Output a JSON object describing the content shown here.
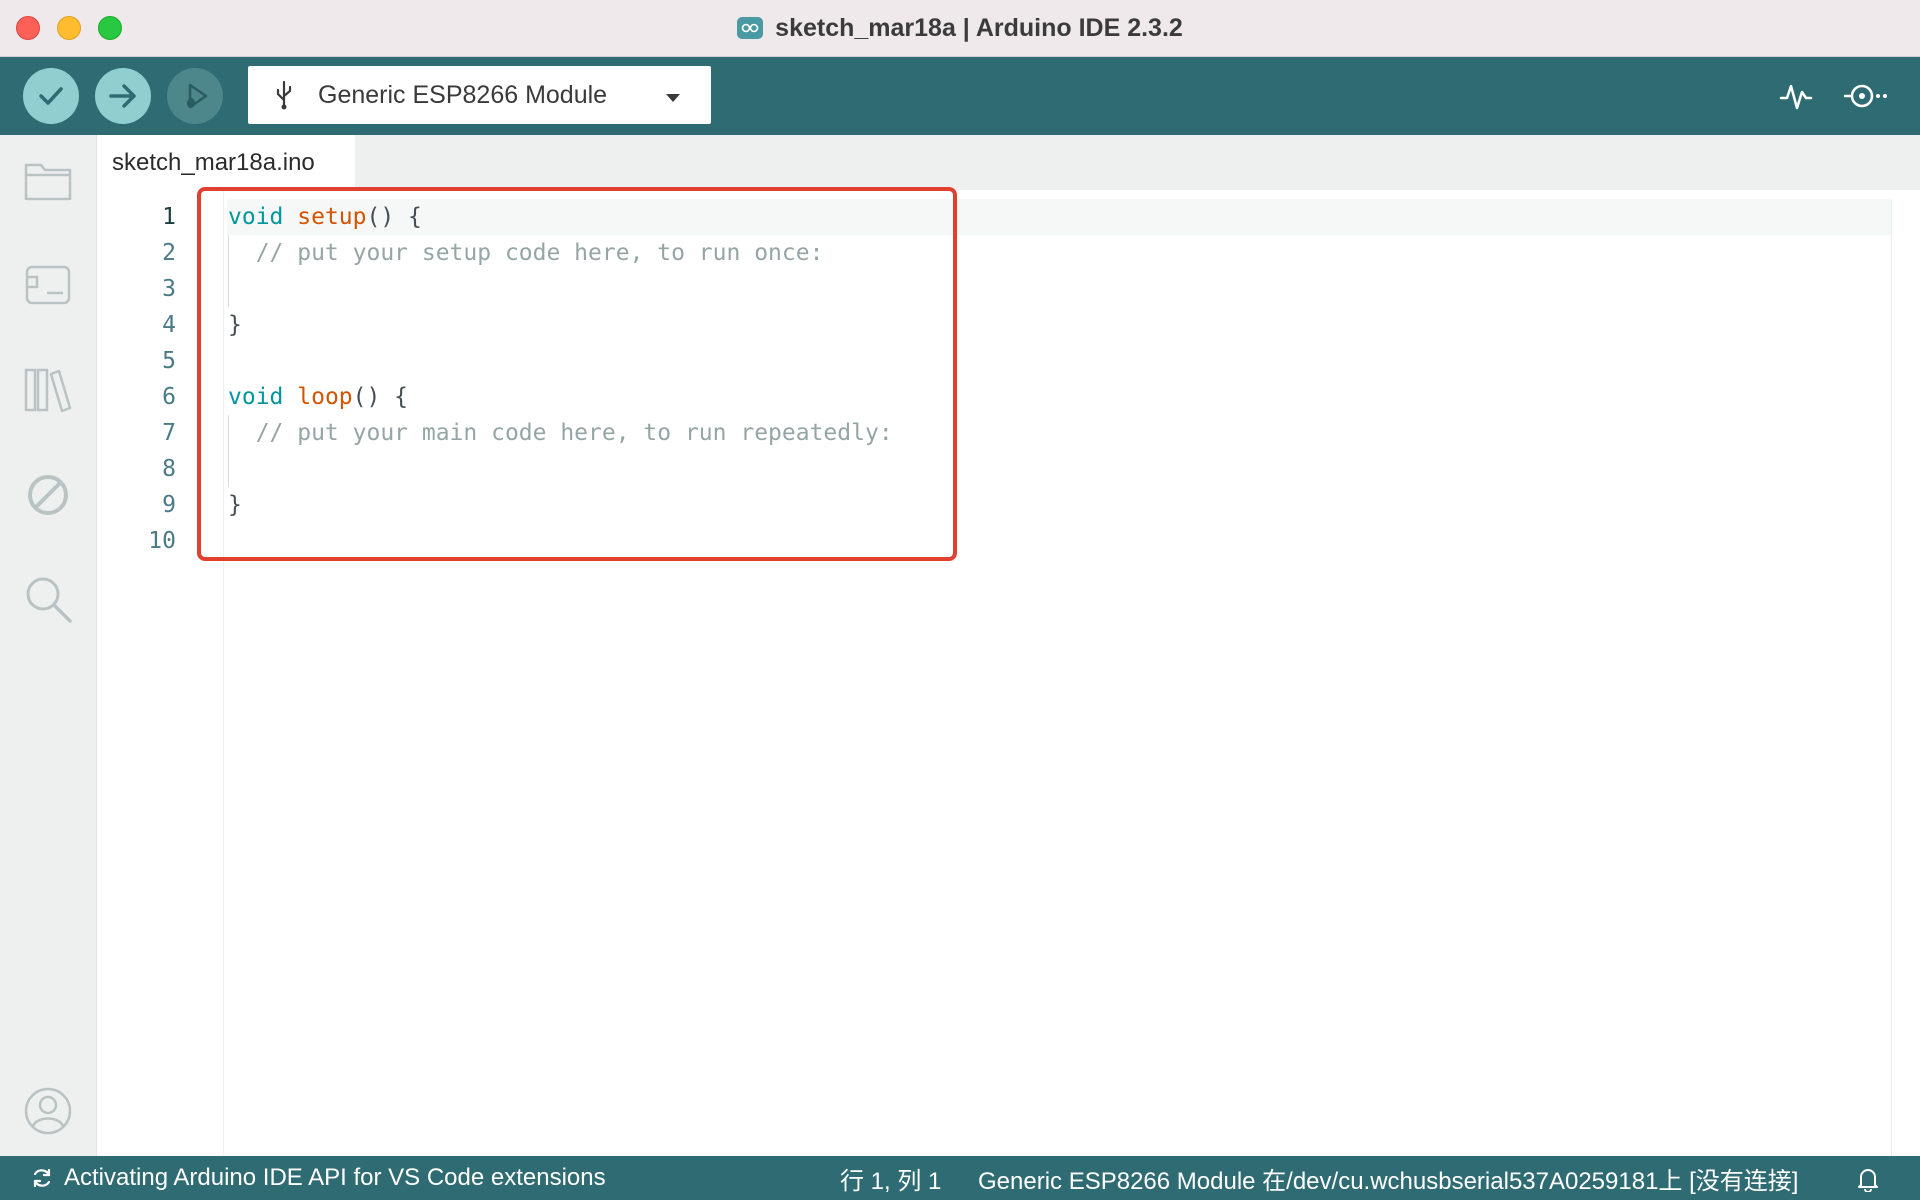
{
  "window": {
    "title": "sketch_mar18a | Arduino IDE 2.3.2"
  },
  "toolbar": {
    "verify_icon": "check-icon",
    "upload_icon": "arrow-right-icon",
    "debug_icon": "debug-icon",
    "board_select": "Generic ESP8266 Module",
    "plotter_icon": "serial-plotter-icon",
    "monitor_icon": "serial-monitor-icon"
  },
  "sidebar": {
    "items": [
      {
        "icon": "folder-icon",
        "label": "Sketchbook"
      },
      {
        "icon": "boards-manager-icon",
        "label": "Boards Manager"
      },
      {
        "icon": "library-icon",
        "label": "Library Manager"
      },
      {
        "icon": "debug-disabled-icon",
        "label": "Debug"
      },
      {
        "icon": "search-icon",
        "label": "Search"
      },
      {
        "icon": "profile-icon",
        "label": "Profile"
      }
    ]
  },
  "editor": {
    "active_tab": "sketch_mar18a.ino",
    "line_numbers": [
      "1",
      "2",
      "3",
      "4",
      "5",
      "6",
      "7",
      "8",
      "9",
      "10"
    ],
    "code": {
      "l1_kw": "void",
      "l1_fn": "setup",
      "l1_rest": "() {",
      "l2": "  // put your setup code here, to run once:",
      "l4": "}",
      "l6_kw": "void",
      "l6_fn": "loop",
      "l6_rest": "() {",
      "l7": "  // put your main code here, to run repeatedly:",
      "l9": "}"
    }
  },
  "status": {
    "activity": "Activating Arduino IDE API for VS Code extensions",
    "cursor_position": "行 1, 列 1",
    "board_info": "Generic ESP8266 Module 在/dev/cu.wchusbserial537A0259181上 [没有连接]"
  },
  "colors": {
    "toolbar": "#2f6b72",
    "keyword": "#00979c",
    "function": "#d35400",
    "comment": "#95a5a6",
    "highlight": "#e2402f"
  }
}
